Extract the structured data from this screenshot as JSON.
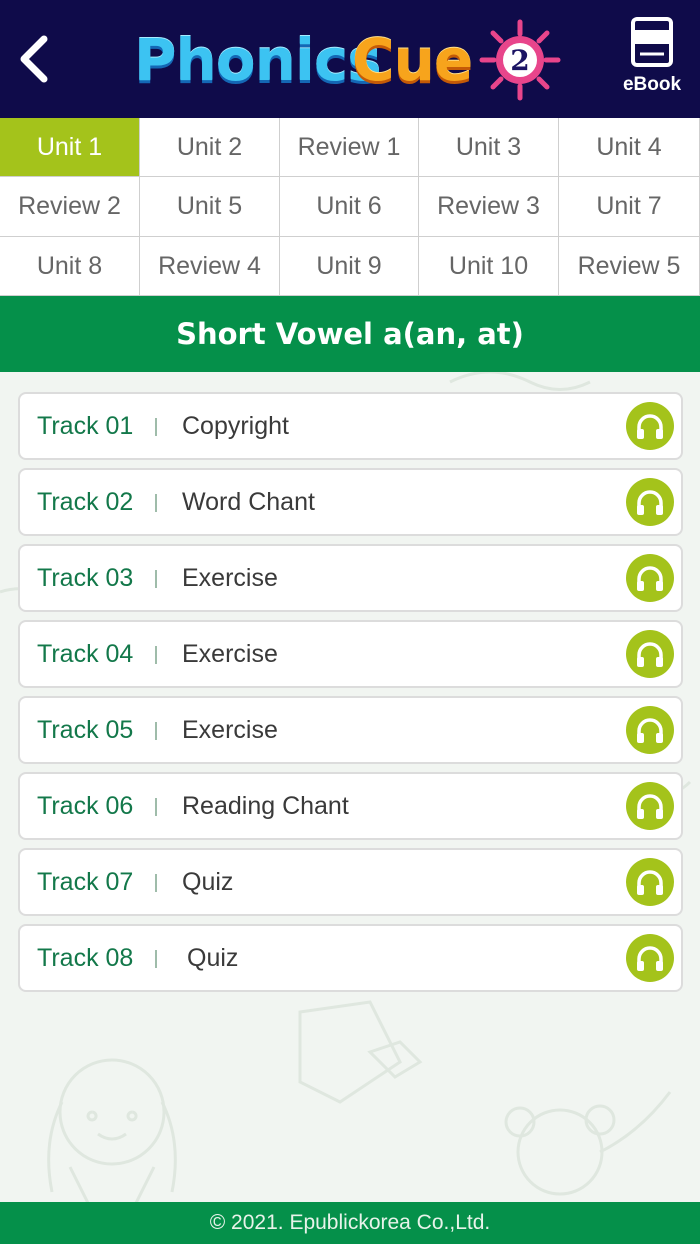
{
  "header": {
    "back_icon": "chevron-left-icon",
    "logo": {
      "word1": "Phonics",
      "word2": "Cue",
      "level": "2"
    },
    "ebook_icon": "book-icon",
    "ebook_label": "eBook"
  },
  "units": {
    "selected": "Unit 1",
    "items": [
      "Unit 1",
      "Unit 2",
      "Review 1",
      "Unit 3",
      "Unit 4",
      "Review 2",
      "Unit 5",
      "Unit 6",
      "Review 3",
      "Unit 7",
      "Unit 8",
      "Review 4",
      "Unit 9",
      "Unit 10",
      "Review 5"
    ]
  },
  "section": {
    "title": "Short Vowel a(an, at)"
  },
  "tracks": [
    {
      "number": "Track 01",
      "title": "Copyright"
    },
    {
      "number": "Track 02",
      "title": "Word Chant"
    },
    {
      "number": "Track 03",
      "title": "Exercise"
    },
    {
      "number": "Track 04",
      "title": "Exercise"
    },
    {
      "number": "Track 05",
      "title": "Exercise"
    },
    {
      "number": "Track 06",
      "title": "Reading Chant"
    },
    {
      "number": "Track 07",
      "title": "Quiz"
    },
    {
      "number": "Track 08",
      "title": "Quiz"
    }
  ],
  "track_icon": "headphones-icon",
  "footer": {
    "copyright": "© 2021. Epublickorea Co.,Ltd."
  },
  "colors": {
    "header_bg": "#0f0b4a",
    "accent_green": "#05904a",
    "active_unit": "#a4c31b",
    "track_number": "#13784a"
  }
}
